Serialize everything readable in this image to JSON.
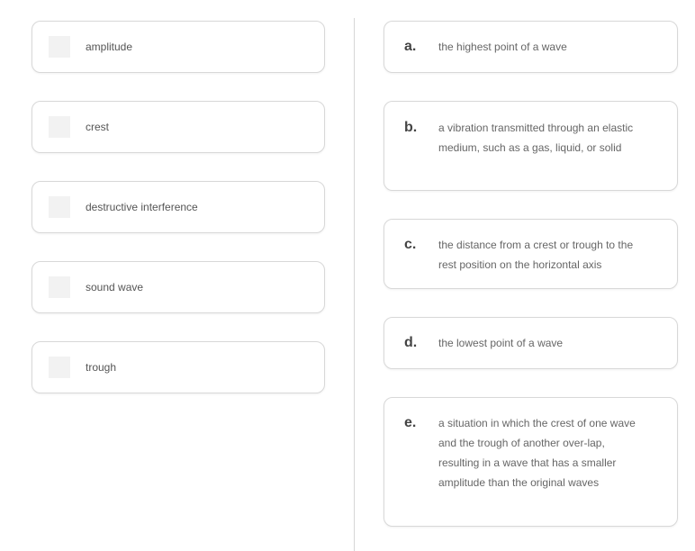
{
  "terms": [
    {
      "label": "amplitude"
    },
    {
      "label": "crest"
    },
    {
      "label": "destructive interference"
    },
    {
      "label": "sound wave"
    },
    {
      "label": "trough"
    }
  ],
  "definitions": [
    {
      "letter": "a.",
      "text": "the highest point of a wave"
    },
    {
      "letter": "b.",
      "text": "a vibration transmitted through an elastic medium, such as a gas, liquid, or solid"
    },
    {
      "letter": "c.",
      "text": "the distance from a crest or trough to the rest position on the horizontal axis"
    },
    {
      "letter": "d.",
      "text": "the lowest point of a wave"
    },
    {
      "letter": "e.",
      "text": "a situation in which the crest of one wave and the trough of another over-lap, resulting in a wave that has a smaller amplitude than the original waves"
    }
  ]
}
